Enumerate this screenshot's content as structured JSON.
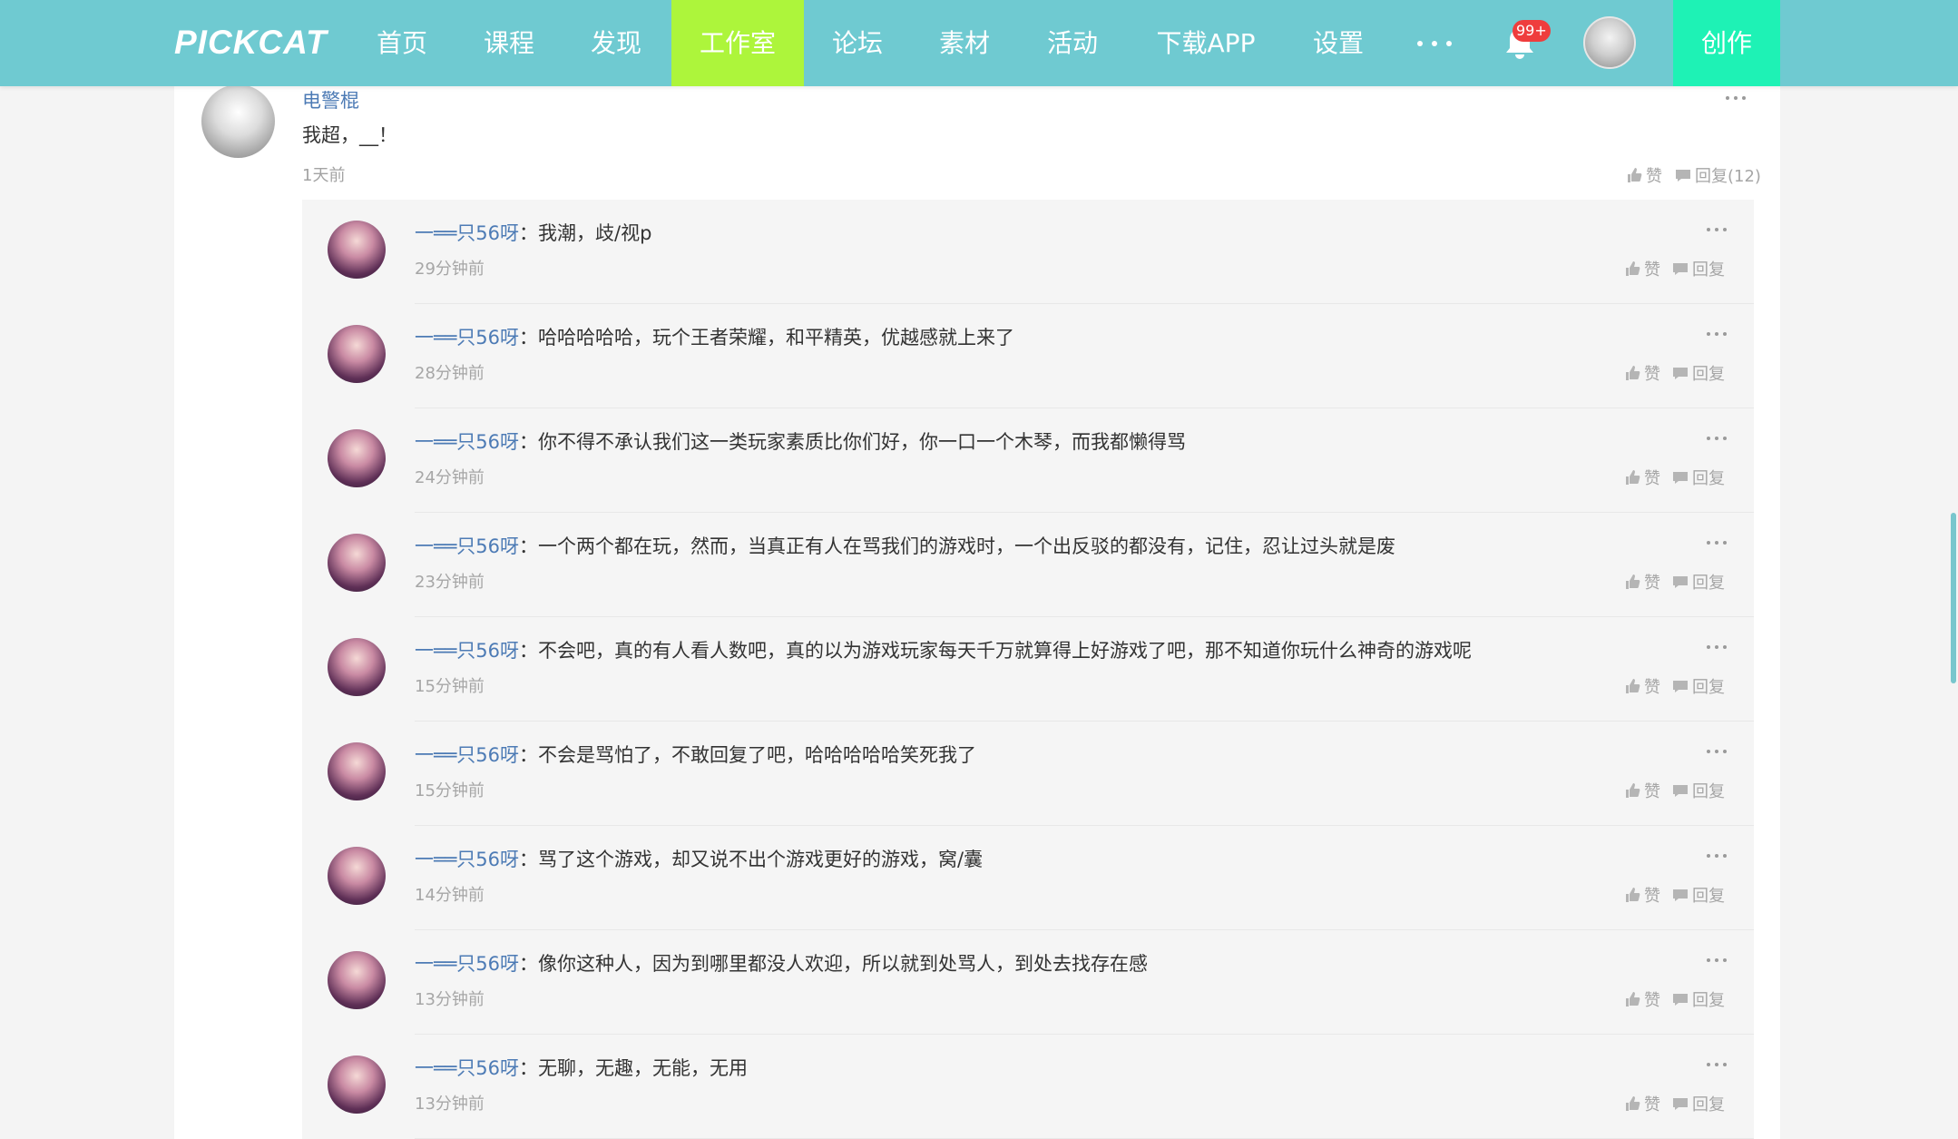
{
  "nav": {
    "logo": "PICKCAT",
    "items": [
      "首页",
      "课程",
      "发现",
      "工作室",
      "论坛",
      "素材",
      "活动",
      "下载APP",
      "设置"
    ],
    "active_index": 3,
    "notification_badge": "99+",
    "create_label": "创作",
    "colors": {
      "bar": "#6fcad1",
      "active": "#adf53b",
      "create": "#1ef2b5"
    }
  },
  "parent_comment": {
    "author": "电警棍",
    "text": "我超，__！",
    "time": "1天前",
    "like_label": "赞",
    "reply_label": "回复(12)"
  },
  "replies": [
    {
      "author": "一══只56呀",
      "text": "我潮，歧/视p",
      "time": "29分钟前"
    },
    {
      "author": "一══只56呀",
      "text": "哈哈哈哈哈，玩个王者荣耀，和平精英，优越感就上来了",
      "time": "28分钟前"
    },
    {
      "author": "一══只56呀",
      "text": "你不得不承认我们这一类玩家素质比你们好，你一口一个木琴，而我都懒得骂",
      "time": "24分钟前"
    },
    {
      "author": "一══只56呀",
      "text": "一个两个都在玩，然而，当真正有人在骂我们的游戏时，一个出反驳的都没有，记住，忍让过头就是废",
      "time": "23分钟前"
    },
    {
      "author": "一══只56呀",
      "text": "不会吧，真的有人看人数吧，真的以为游戏玩家每天千万就算得上好游戏了吧，那不知道你玩什么神奇的游戏呢",
      "time": "15分钟前"
    },
    {
      "author": "一══只56呀",
      "text": "不会是骂怕了，不敢回复了吧，哈哈哈哈哈笑死我了",
      "time": "15分钟前"
    },
    {
      "author": "一══只56呀",
      "text": "骂了这个游戏，却又说不出个游戏更好的游戏，窝/囊",
      "time": "14分钟前"
    },
    {
      "author": "一══只56呀",
      "text": "像你这种人，因为到哪里都没人欢迎，所以就到处骂人，到处去找存在感",
      "time": "13分钟前"
    },
    {
      "author": "一══只56呀",
      "text": "无聊，无趣，无能，无用",
      "time": "13分钟前"
    }
  ],
  "reply_actions": {
    "like_label": "赞",
    "reply_label": "回复",
    "colon": "："
  }
}
